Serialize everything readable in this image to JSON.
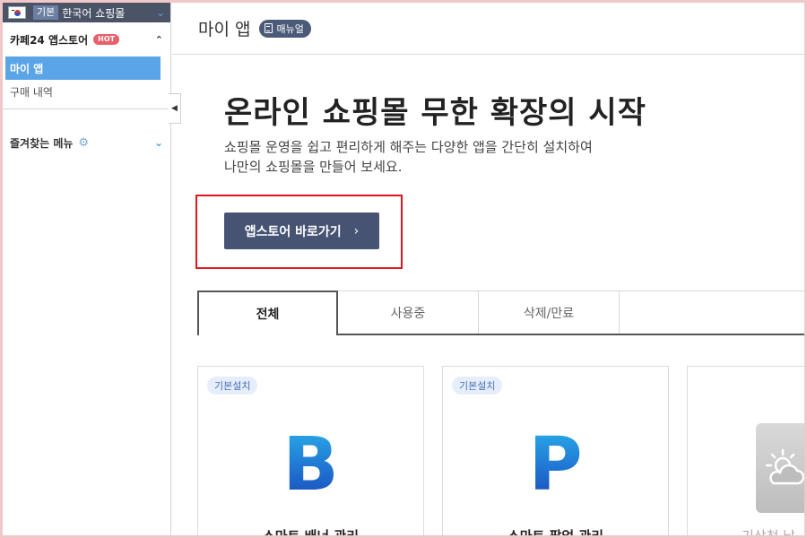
{
  "sidebar": {
    "shop": {
      "badge": "기본",
      "name": "한국어 쇼핑몰"
    },
    "appstore": {
      "title": "카페24 앱스토어",
      "hot": "HOT"
    },
    "menu": [
      {
        "label": "마이 앱",
        "active": true
      },
      {
        "label": "구매 내역",
        "active": false
      }
    ],
    "favorites": {
      "title": "즐겨찾는 메뉴"
    }
  },
  "header": {
    "title": "마이 앱",
    "manual": "매뉴얼"
  },
  "hero": {
    "title": "온라인 쇼핑몰 무한 확장의 시작",
    "desc_line1": "쇼핑몰 운영을 쉽고 편리하게 해주는 다양한 앱을 간단히 설치하여",
    "desc_line2": "나만의 쇼핑몰을 만들어 보세요.",
    "cta": "앱스토어 바로가기"
  },
  "tabs": [
    {
      "label": "전체",
      "active": true
    },
    {
      "label": "사용중",
      "active": false
    },
    {
      "label": "삭제/만료",
      "active": false
    }
  ],
  "cards": [
    {
      "badge": "기본설치",
      "logo": "B",
      "title": "스마트 배너 관리"
    },
    {
      "badge": "기본설치",
      "logo": "P",
      "title": "스마트 팝업 관리"
    },
    {
      "title": "기상청 날씨"
    }
  ],
  "colors": {
    "accent": "#465373",
    "highlight": "#e0141e",
    "active_menu": "#5aa5e8"
  }
}
